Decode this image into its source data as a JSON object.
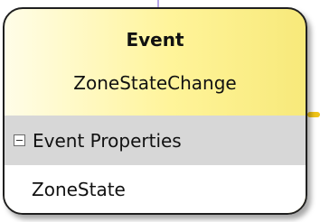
{
  "event_shape": {
    "stereotype": "Event",
    "name": "ZoneStateChange",
    "compartment": {
      "title": "Event Properties",
      "toggle_icon": "collapse-minus-icon",
      "properties": [
        "ZoneState"
      ]
    }
  },
  "colors": {
    "fill_light": "#fffde8",
    "fill_dark": "#f7e97a",
    "border": "#1f1f1f",
    "compartment_header": "#d7d7d7",
    "connector_top": "#b7a6e8",
    "connector_right": "#f0c418"
  }
}
